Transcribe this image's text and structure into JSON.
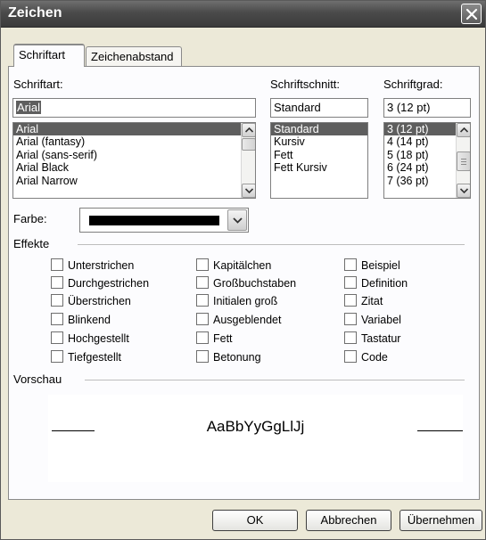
{
  "window": {
    "title": "Zeichen"
  },
  "tabs": [
    {
      "label": "Schriftart",
      "active": true
    },
    {
      "label": "Zeichenabstand",
      "active": false
    }
  ],
  "font": {
    "label": "Schriftart:",
    "value": "Arial",
    "items": [
      "Arial",
      "Arial (fantasy)",
      "Arial (sans-serif)",
      "Arial Black",
      "Arial Narrow"
    ],
    "selected": 0
  },
  "style": {
    "label": "Schriftschnitt:",
    "value": "Standard",
    "items": [
      "Standard",
      "Kursiv",
      "Fett",
      "Fett Kursiv"
    ],
    "selected": 0
  },
  "size": {
    "label": "Schriftgrad:",
    "value": "3  (12 pt)",
    "items": [
      "3  (12 pt)",
      "4  (14 pt)",
      "5  (18 pt)",
      "6  (24 pt)",
      "7  (36 pt)"
    ],
    "selected": 0
  },
  "color": {
    "label": "Farbe:",
    "value": "#000000"
  },
  "effects": {
    "label": "Effekte",
    "col1": [
      "Unterstrichen",
      "Durchgestrichen",
      "Überstrichen",
      "Blinkend",
      "Hochgestellt",
      "Tiefgestellt"
    ],
    "col2": [
      "Kapitälchen",
      "Großbuchstaben",
      "Initialen groß",
      "Ausgeblendet",
      "Fett",
      "Betonung"
    ],
    "col3": [
      "Beispiel",
      "Definition",
      "Zitat",
      "Variabel",
      "Tastatur",
      "Code"
    ]
  },
  "preview": {
    "label": "Vorschau",
    "text": "AaBbYyGgLlJj"
  },
  "buttons": {
    "ok": "OK",
    "cancel": "Abbrechen",
    "apply": "Übernehmen"
  }
}
